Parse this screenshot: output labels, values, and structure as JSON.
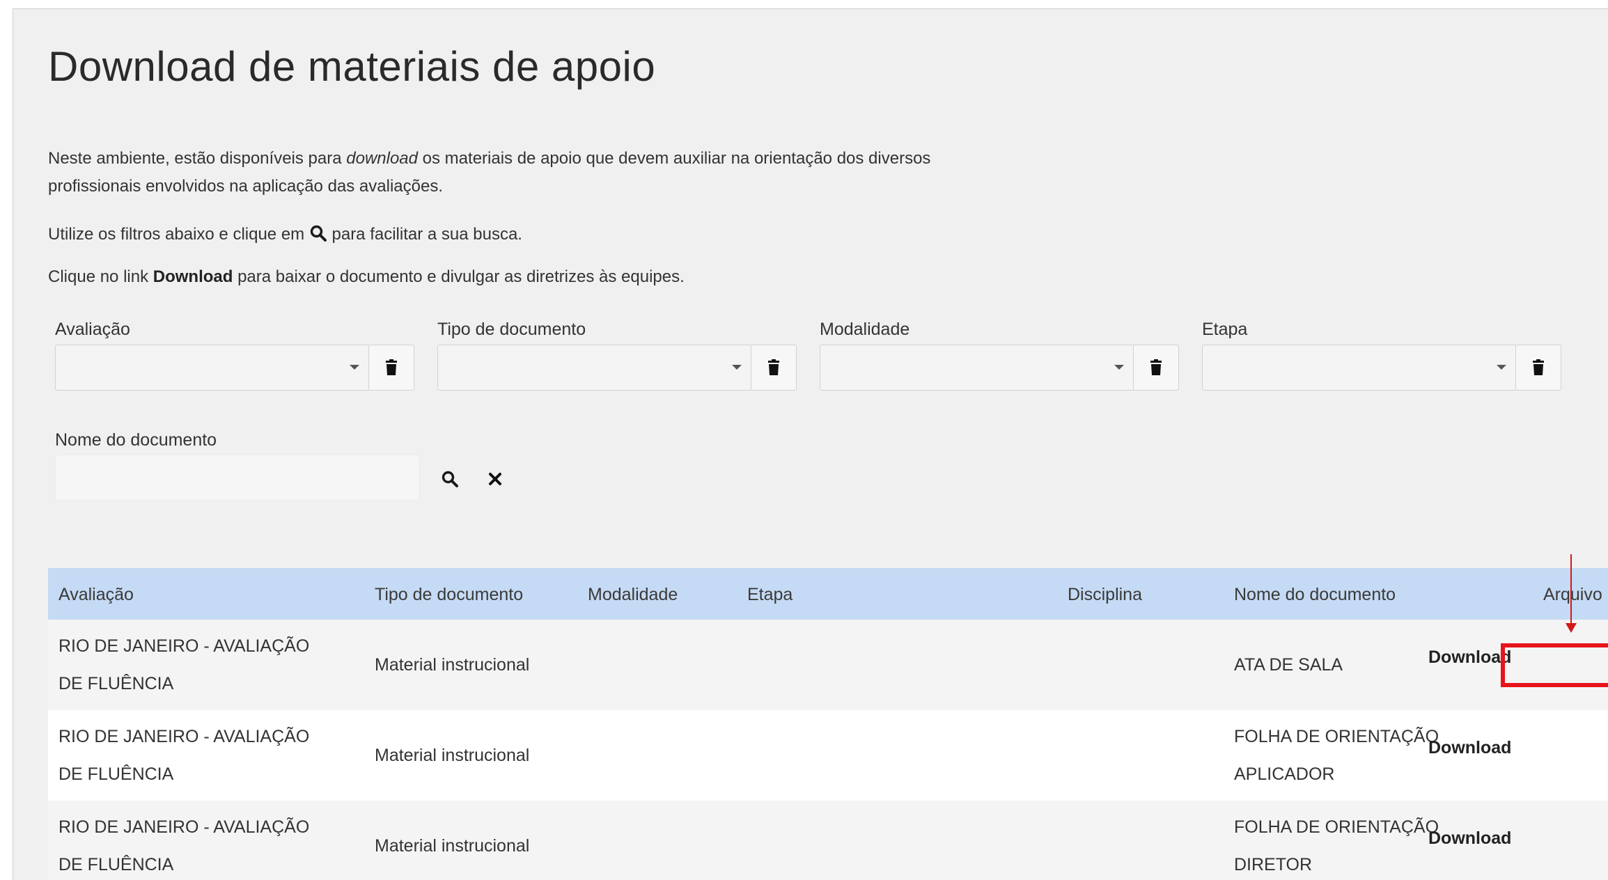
{
  "page": {
    "title": "Download de materiais de apoio",
    "intro_part1": "Neste ambiente, estão disponíveis para ",
    "intro_emphasis": "download",
    "intro_part2": " os materiais de apoio que devem auxiliar na orientação dos diversos profissionais envolvidos na aplicação das avaliações.",
    "filters_hint_before": "Utilize os filtros abaixo e clique em ",
    "filters_hint_after": " para facilitar a sua busca.",
    "download_hint_before": "Clique no link ",
    "download_hint_bold": "Download",
    "download_hint_after": " para baixar o documento e divulgar as diretrizes às equipes."
  },
  "filters": {
    "avaliacao_label": "Avaliação",
    "tipo_label": "Tipo de documento",
    "modalidade_label": "Modalidade",
    "etapa_label": "Etapa",
    "nome_label": "Nome do documento",
    "nome_value": ""
  },
  "table": {
    "headers": {
      "avaliacao": "Avaliação",
      "tipo": "Tipo de documento",
      "modalidade": "Modalidade",
      "etapa": "Etapa",
      "disciplina": "Disciplina",
      "nome": "Nome do documento",
      "arquivo": "Arquivo"
    },
    "rows": [
      {
        "avaliacao_line1": "RIO DE JANEIRO - AVALIAÇÃO",
        "avaliacao_line2": "DE FLUÊNCIA",
        "tipo": "Material instrucional",
        "nome_line1": "ATA DE SALA",
        "nome_line2": "",
        "arquivo": "Download"
      },
      {
        "avaliacao_line1": "RIO DE JANEIRO - AVALIAÇÃO",
        "avaliacao_line2": "DE FLUÊNCIA",
        "tipo": "Material instrucional",
        "nome_line1": "FOLHA DE ORIENTAÇÃO",
        "nome_line2": "APLICADOR",
        "arquivo": "Download"
      },
      {
        "avaliacao_line1": "RIO DE JANEIRO - AVALIAÇÃO",
        "avaliacao_line2": "DE FLUÊNCIA",
        "tipo": "Material instrucional",
        "nome_line1": "FOLHA DE ORIENTAÇÃO",
        "nome_line2": "DIRETOR",
        "arquivo": "Download"
      }
    ]
  },
  "annotation": {
    "highlight_color": "#e8141b",
    "arrow_color": "#d41818"
  },
  "colors": {
    "table_header_bg": "#c5daf4",
    "page_bg": "#f0f0f0"
  }
}
